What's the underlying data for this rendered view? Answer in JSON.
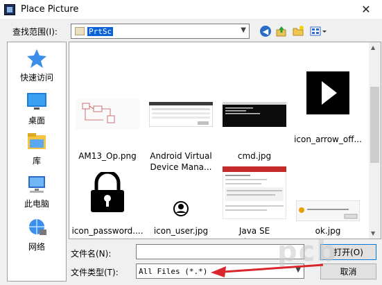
{
  "window": {
    "title": "Place Picture",
    "close_glyph": "✕"
  },
  "lookin": {
    "label": "查找范围(I):",
    "value": "PrtSc"
  },
  "toolbar": {
    "back_icon": "back-arrow-icon",
    "up_icon": "up-folder-icon",
    "new_icon": "new-folder-icon",
    "view_icon": "view-menu-icon"
  },
  "places": [
    {
      "label": "快速访问",
      "icon": "star-icon"
    },
    {
      "label": "桌面",
      "icon": "desktop-icon"
    },
    {
      "label": "库",
      "icon": "library-icon"
    },
    {
      "label": "此电脑",
      "icon": "computer-icon"
    },
    {
      "label": "网络",
      "icon": "network-icon"
    }
  ],
  "files": [
    {
      "label": "AM13_Op.png"
    },
    {
      "label": "Android Virtual Device Mana..."
    },
    {
      "label": "cmd.jpg"
    },
    {
      "label": "icon_arrow_off..."
    },
    {
      "label": "icon_password...."
    },
    {
      "label": "icon_user.jpg"
    },
    {
      "label": "Java SE Development..."
    },
    {
      "label": "ok.jpg"
    }
  ],
  "filename": {
    "label": "文件名(N):",
    "value": ""
  },
  "filetype": {
    "label": "文件类型(T):",
    "value": "All Files (*.*)"
  },
  "buttons": {
    "open": "打开(O)",
    "cancel": "取消"
  },
  "watermark": "pcb",
  "colors": {
    "accent": "#0078d7",
    "selection": "#0a64d8",
    "annotation_arrow": "#d9262c"
  }
}
